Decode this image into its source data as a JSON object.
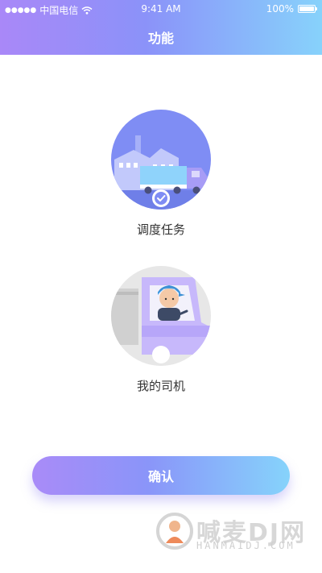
{
  "status_bar": {
    "signal_dots": "●●●●●",
    "carrier": "中国电信",
    "time": "9:41 AM",
    "battery": "100%",
    "wifi_icon": "wifi-icon",
    "battery_icon": "battery-icon"
  },
  "header": {
    "title": "功能"
  },
  "functions": [
    {
      "label": "调度任务",
      "icon": "dispatch-task-icon",
      "selected": true
    },
    {
      "label": "我的司机",
      "icon": "my-driver-icon",
      "selected": false
    }
  ],
  "confirm_button": {
    "label": "确认"
  },
  "watermark": {
    "text": "喊麦DJ网",
    "sub": "HANMAIDJ.COM"
  },
  "colors": {
    "header_gradient": [
      "#a988f8",
      "#87d2fb"
    ],
    "accent": "#8b92f9",
    "label_text": "#333333"
  }
}
